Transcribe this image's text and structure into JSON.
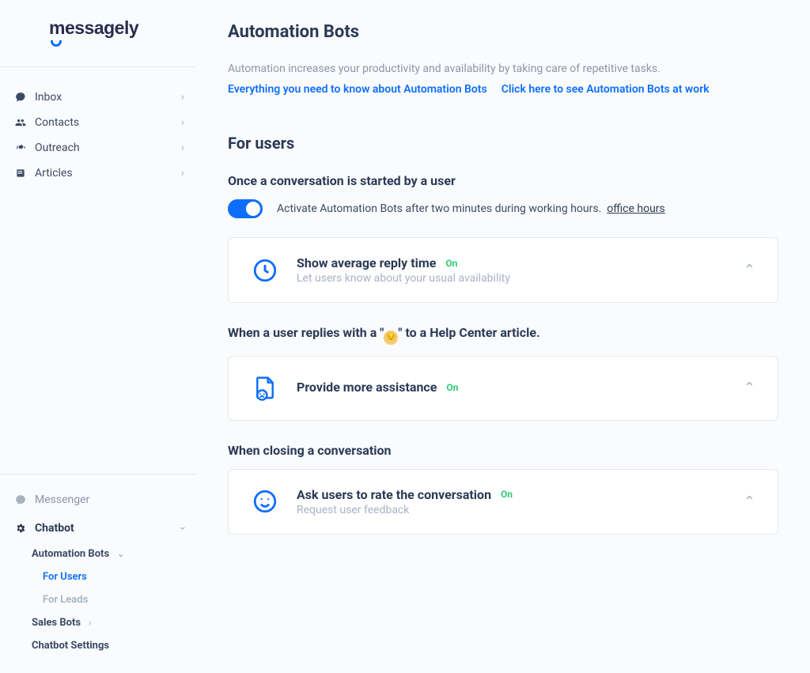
{
  "logo": {
    "text": "messagely"
  },
  "sidebar": {
    "top": [
      {
        "label": "Inbox",
        "icon": "chat"
      },
      {
        "label": "Contacts",
        "icon": "people"
      },
      {
        "label": "Outreach",
        "icon": "megaphone"
      },
      {
        "label": "Articles",
        "icon": "book"
      }
    ],
    "bottom": {
      "messenger_label": "Messenger",
      "chatbot_label": "Chatbot",
      "automation_bots_label": "Automation Bots",
      "for_users_label": "For Users",
      "for_leads_label": "For Leads",
      "sales_bots_label": "Sales Bots",
      "chatbot_settings_label": "Chatbot Settings"
    }
  },
  "main": {
    "page_title": "Automation Bots",
    "page_desc": "Automation increases your productivity and availability by taking care of repetitive tasks.",
    "help_link_1": "Everything you need to know about Automation Bots",
    "help_link_2": "Click here to see Automation Bots at work",
    "section_title": "For users",
    "subsection_1": "Once a conversation is started by a user",
    "toggle_text": "Activate Automation Bots after two minutes during working hours.",
    "toggle_link": "office hours",
    "card1": {
      "title": "Show average reply time",
      "status": "On",
      "sub": "Let users know about your usual availability"
    },
    "subsection_2_prefix": "When a user replies with a \"",
    "subsection_2_suffix": "\" to a Help Center article.",
    "card2": {
      "title": "Provide more assistance",
      "status": "On"
    },
    "subsection_3": "When closing a conversation",
    "card3": {
      "title": "Ask users to rate the conversation",
      "status": "On",
      "sub": "Request user feedback"
    }
  }
}
